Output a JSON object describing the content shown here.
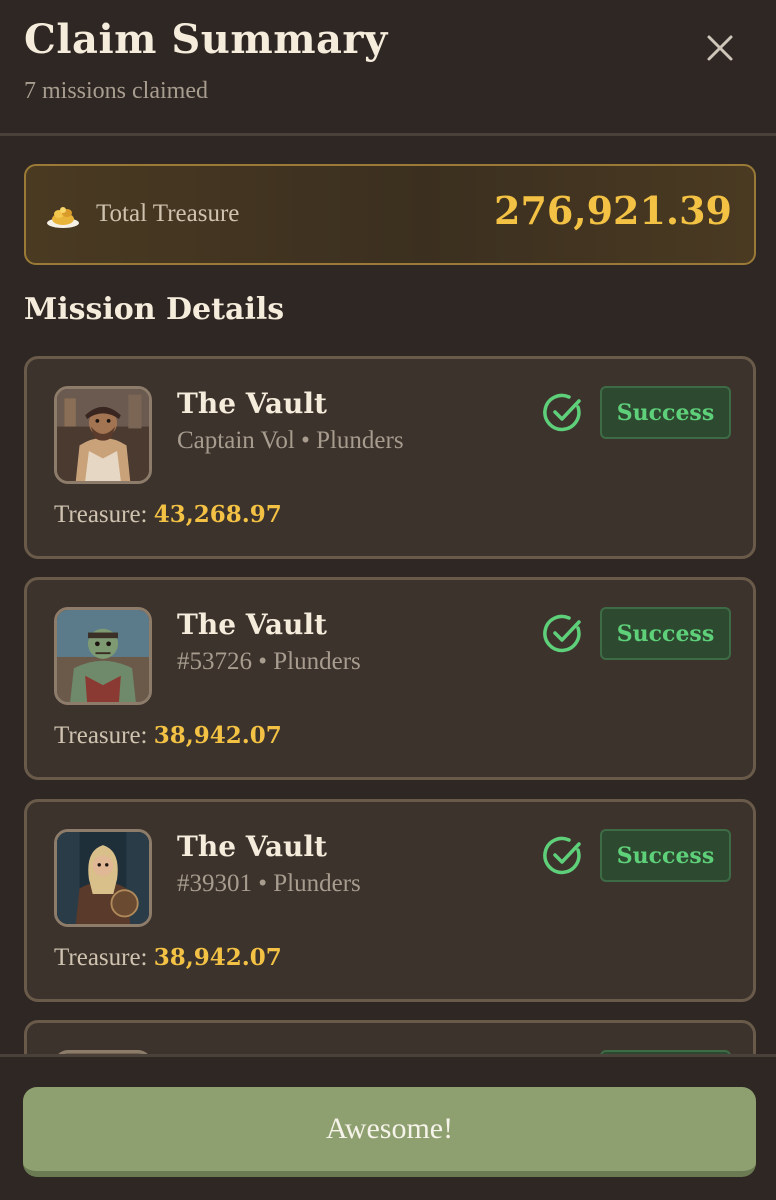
{
  "header": {
    "title": "Claim Summary",
    "subtitle": "7 missions claimed",
    "close_icon": "close-icon"
  },
  "total": {
    "icon": "treasure-pile-icon",
    "label": "Total Treasure",
    "value": "276,921.39"
  },
  "section_title": "Mission Details",
  "missions": [
    {
      "title": "The Vault",
      "subtitle": "Captain Vol • Plunders",
      "status": "Success",
      "treasure_label": "Treasure:",
      "treasure_value": "43,268.97"
    },
    {
      "title": "The Vault",
      "subtitle": "#53726 • Plunders",
      "status": "Success",
      "treasure_label": "Treasure:",
      "treasure_value": "38,942.07"
    },
    {
      "title": "The Vault",
      "subtitle": "#39301 • Plunders",
      "status": "Success",
      "treasure_label": "Treasure:",
      "treasure_value": "38,942.07"
    },
    {
      "title": "",
      "subtitle": "",
      "status": "",
      "treasure_label": "",
      "treasure_value": ""
    }
  ],
  "footer": {
    "button_label": "Awesome!"
  },
  "colors": {
    "background": "#2e2723",
    "gold": "#f3c244",
    "success": "#5fd07a",
    "button": "#8fa070"
  }
}
